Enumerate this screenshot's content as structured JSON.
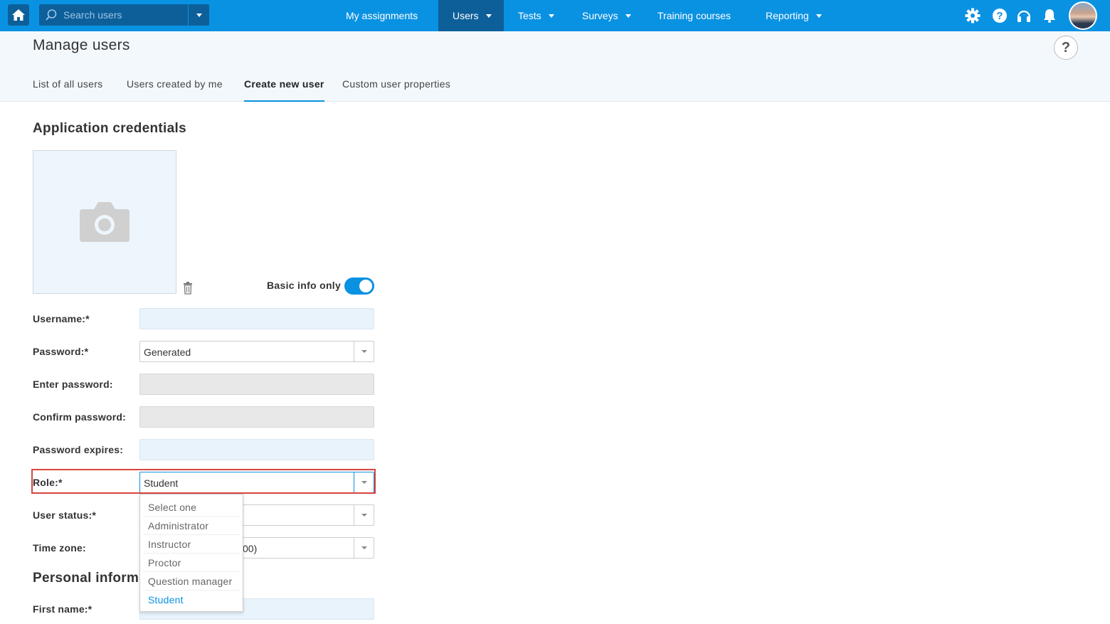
{
  "topbar": {
    "search_placeholder": "Search users",
    "nav": [
      {
        "label": "My assignments",
        "has_menu": false,
        "active": false
      },
      {
        "label": "Users",
        "has_menu": true,
        "active": true
      },
      {
        "label": "Tests",
        "has_menu": true,
        "active": false
      },
      {
        "label": "Surveys",
        "has_menu": true,
        "active": false
      },
      {
        "label": "Training courses",
        "has_menu": false,
        "active": false
      },
      {
        "label": "Reporting",
        "has_menu": true,
        "active": false
      }
    ],
    "icons": [
      "gear-icon",
      "question-icon",
      "headset-icon",
      "bell-icon"
    ]
  },
  "header": {
    "title": "Manage users",
    "help": "?",
    "tabs": [
      {
        "label": "List of all users",
        "active": false
      },
      {
        "label": "Users created by me",
        "active": false
      },
      {
        "label": "Create new user",
        "active": true
      },
      {
        "label": "Custom user properties",
        "active": false
      }
    ]
  },
  "form": {
    "section_credentials": "Application credentials",
    "basic_info_label": "Basic info only",
    "basic_info_on": true,
    "username_label": "Username:*",
    "password_label": "Password:*",
    "password_value": "Generated",
    "enter_password_label": "Enter password:",
    "confirm_password_label": "Confirm password:",
    "password_expires_label": "Password expires:",
    "role_label": "Role:*",
    "role_value": "Student",
    "user_status_label": "User status:*",
    "time_zone_label": "Time zone:",
    "time_zone_value_partial": "00)",
    "section_personal": "Personal inform",
    "first_name_label": "First name:*"
  },
  "role_dropdown": {
    "options": [
      "Select one",
      "Administrator",
      "Instructor",
      "Proctor",
      "Question manager",
      "Student"
    ],
    "selected": "Student"
  },
  "colors": {
    "brand": "#0a92e2",
    "nav_active": "#0d5f9a",
    "highlight": "#d9443f"
  }
}
